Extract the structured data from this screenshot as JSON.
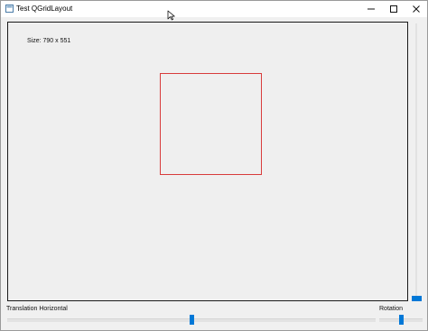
{
  "window": {
    "title": "Test QGridLayout",
    "controls": {
      "minimize_icon": "minimize-icon",
      "maximize_icon": "maximize-icon",
      "close_icon": "close-icon"
    }
  },
  "canvas": {
    "size_label": "Size: 790 x 551",
    "square_color": "#d83b3b"
  },
  "vertical_slider": {
    "value_percent": 100
  },
  "translation_slider": {
    "label": "Translation Horizontal",
    "value_percent": 50
  },
  "rotation_slider": {
    "label": "Rotation",
    "value_percent": 50
  },
  "colors": {
    "accent": "#0078d7",
    "background": "#f0f0f0"
  }
}
